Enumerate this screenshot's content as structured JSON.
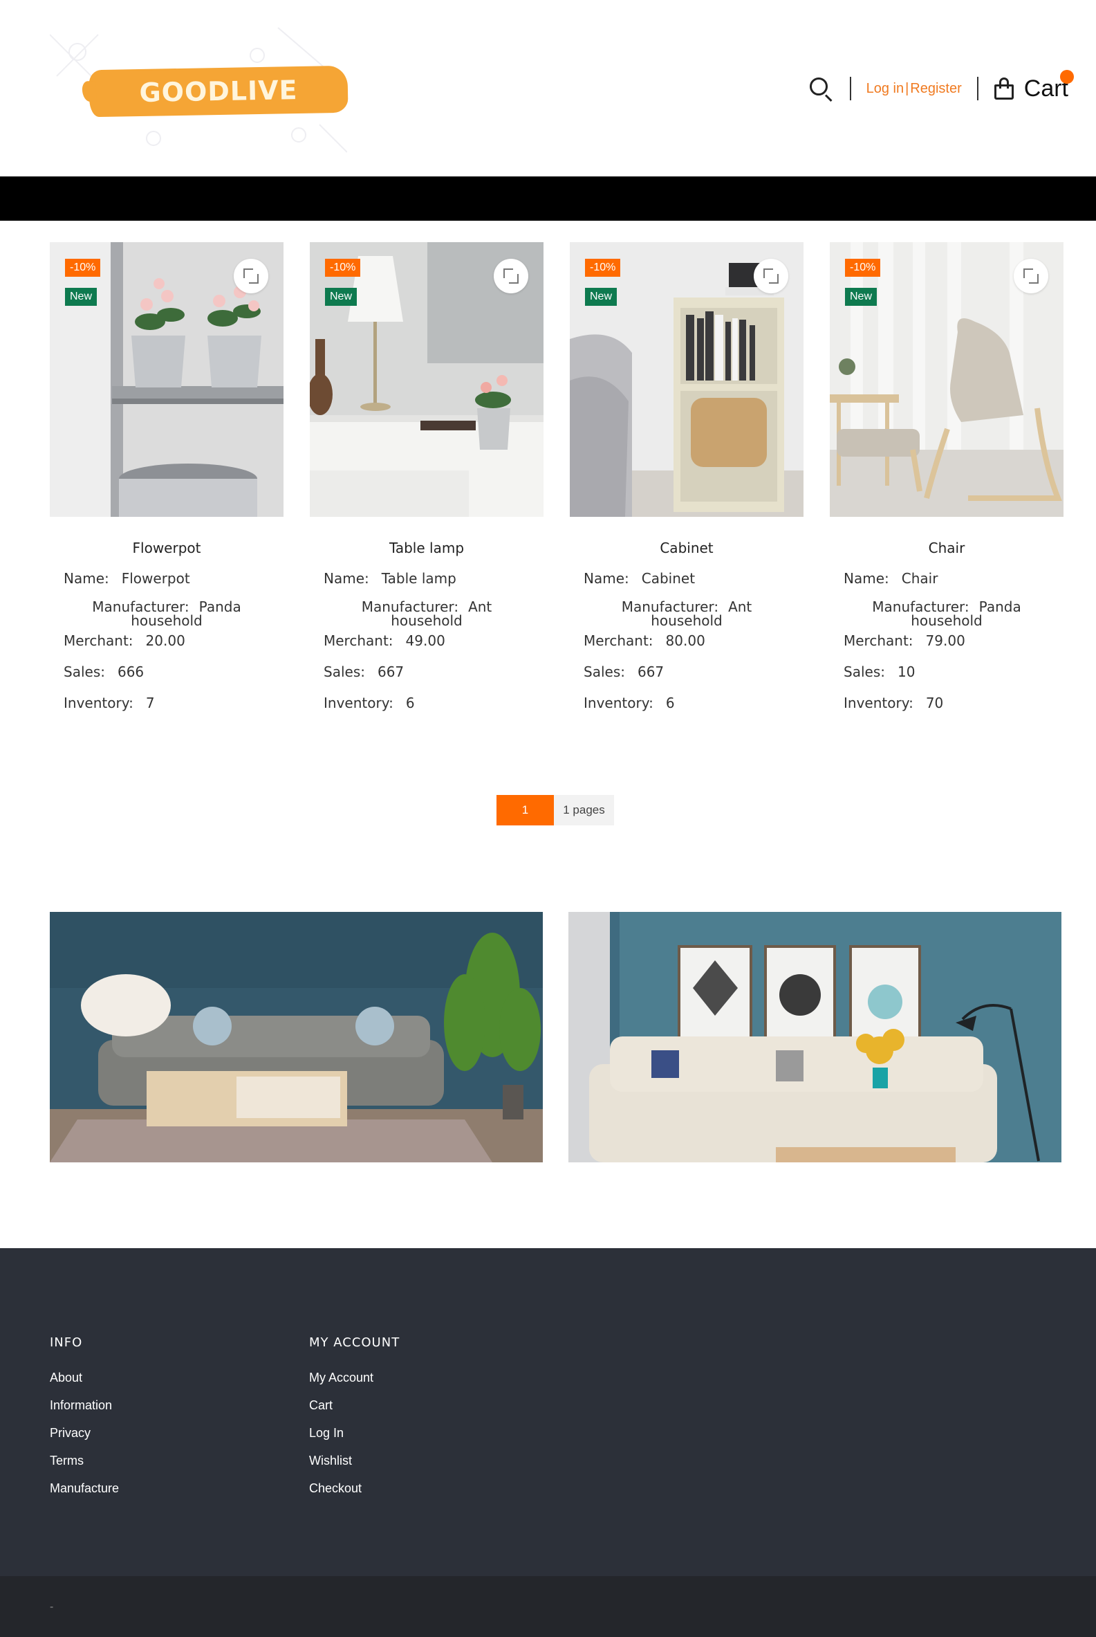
{
  "header": {
    "logo_text": "GOODLIVE",
    "login_label": "Log in",
    "register_label": "Register",
    "separator": "|",
    "cart_label": "Cart"
  },
  "labels": {
    "name": "Name:",
    "manufacturer": "Manufacturer:",
    "merchant": "Merchant:",
    "sales": "Sales:",
    "inventory": "Inventory:"
  },
  "products": [
    {
      "title": "Flowerpot",
      "discount": "-10%",
      "tag": "New",
      "name": "Flowerpot",
      "manufacturer": "Panda household",
      "merchant": "20.00",
      "sales": "666",
      "inventory": "7"
    },
    {
      "title": "Table lamp",
      "discount": "-10%",
      "tag": "New",
      "name": "Table lamp",
      "manufacturer": "Ant household",
      "merchant": "49.00",
      "sales": "667",
      "inventory": "6"
    },
    {
      "title": "Cabinet",
      "discount": "-10%",
      "tag": "New",
      "name": "Cabinet",
      "manufacturer": "Ant household",
      "merchant": "80.00",
      "sales": "667",
      "inventory": "6"
    },
    {
      "title": "Chair",
      "discount": "-10%",
      "tag": "New",
      "name": "Chair",
      "manufacturer": "Panda household",
      "merchant": "79.00",
      "sales": "10",
      "inventory": "70"
    }
  ],
  "pagination": {
    "current": "1",
    "total_label": "1 pages"
  },
  "footer": {
    "info": {
      "heading": "INFO",
      "links": [
        "About",
        "Information",
        "Privacy",
        "Terms",
        "Manufacture"
      ]
    },
    "account": {
      "heading": "MY ACCOUNT",
      "links": [
        "My Account",
        "Cart",
        "Log In",
        "Wishlist",
        "Checkout"
      ]
    },
    "bottom_text": "-"
  },
  "colors": {
    "accent": "#ff6a00",
    "new_badge": "#0e7a4f",
    "footer_bg": "#2c3039",
    "bottom_bg": "#24262b",
    "logo": "#f5a535"
  }
}
